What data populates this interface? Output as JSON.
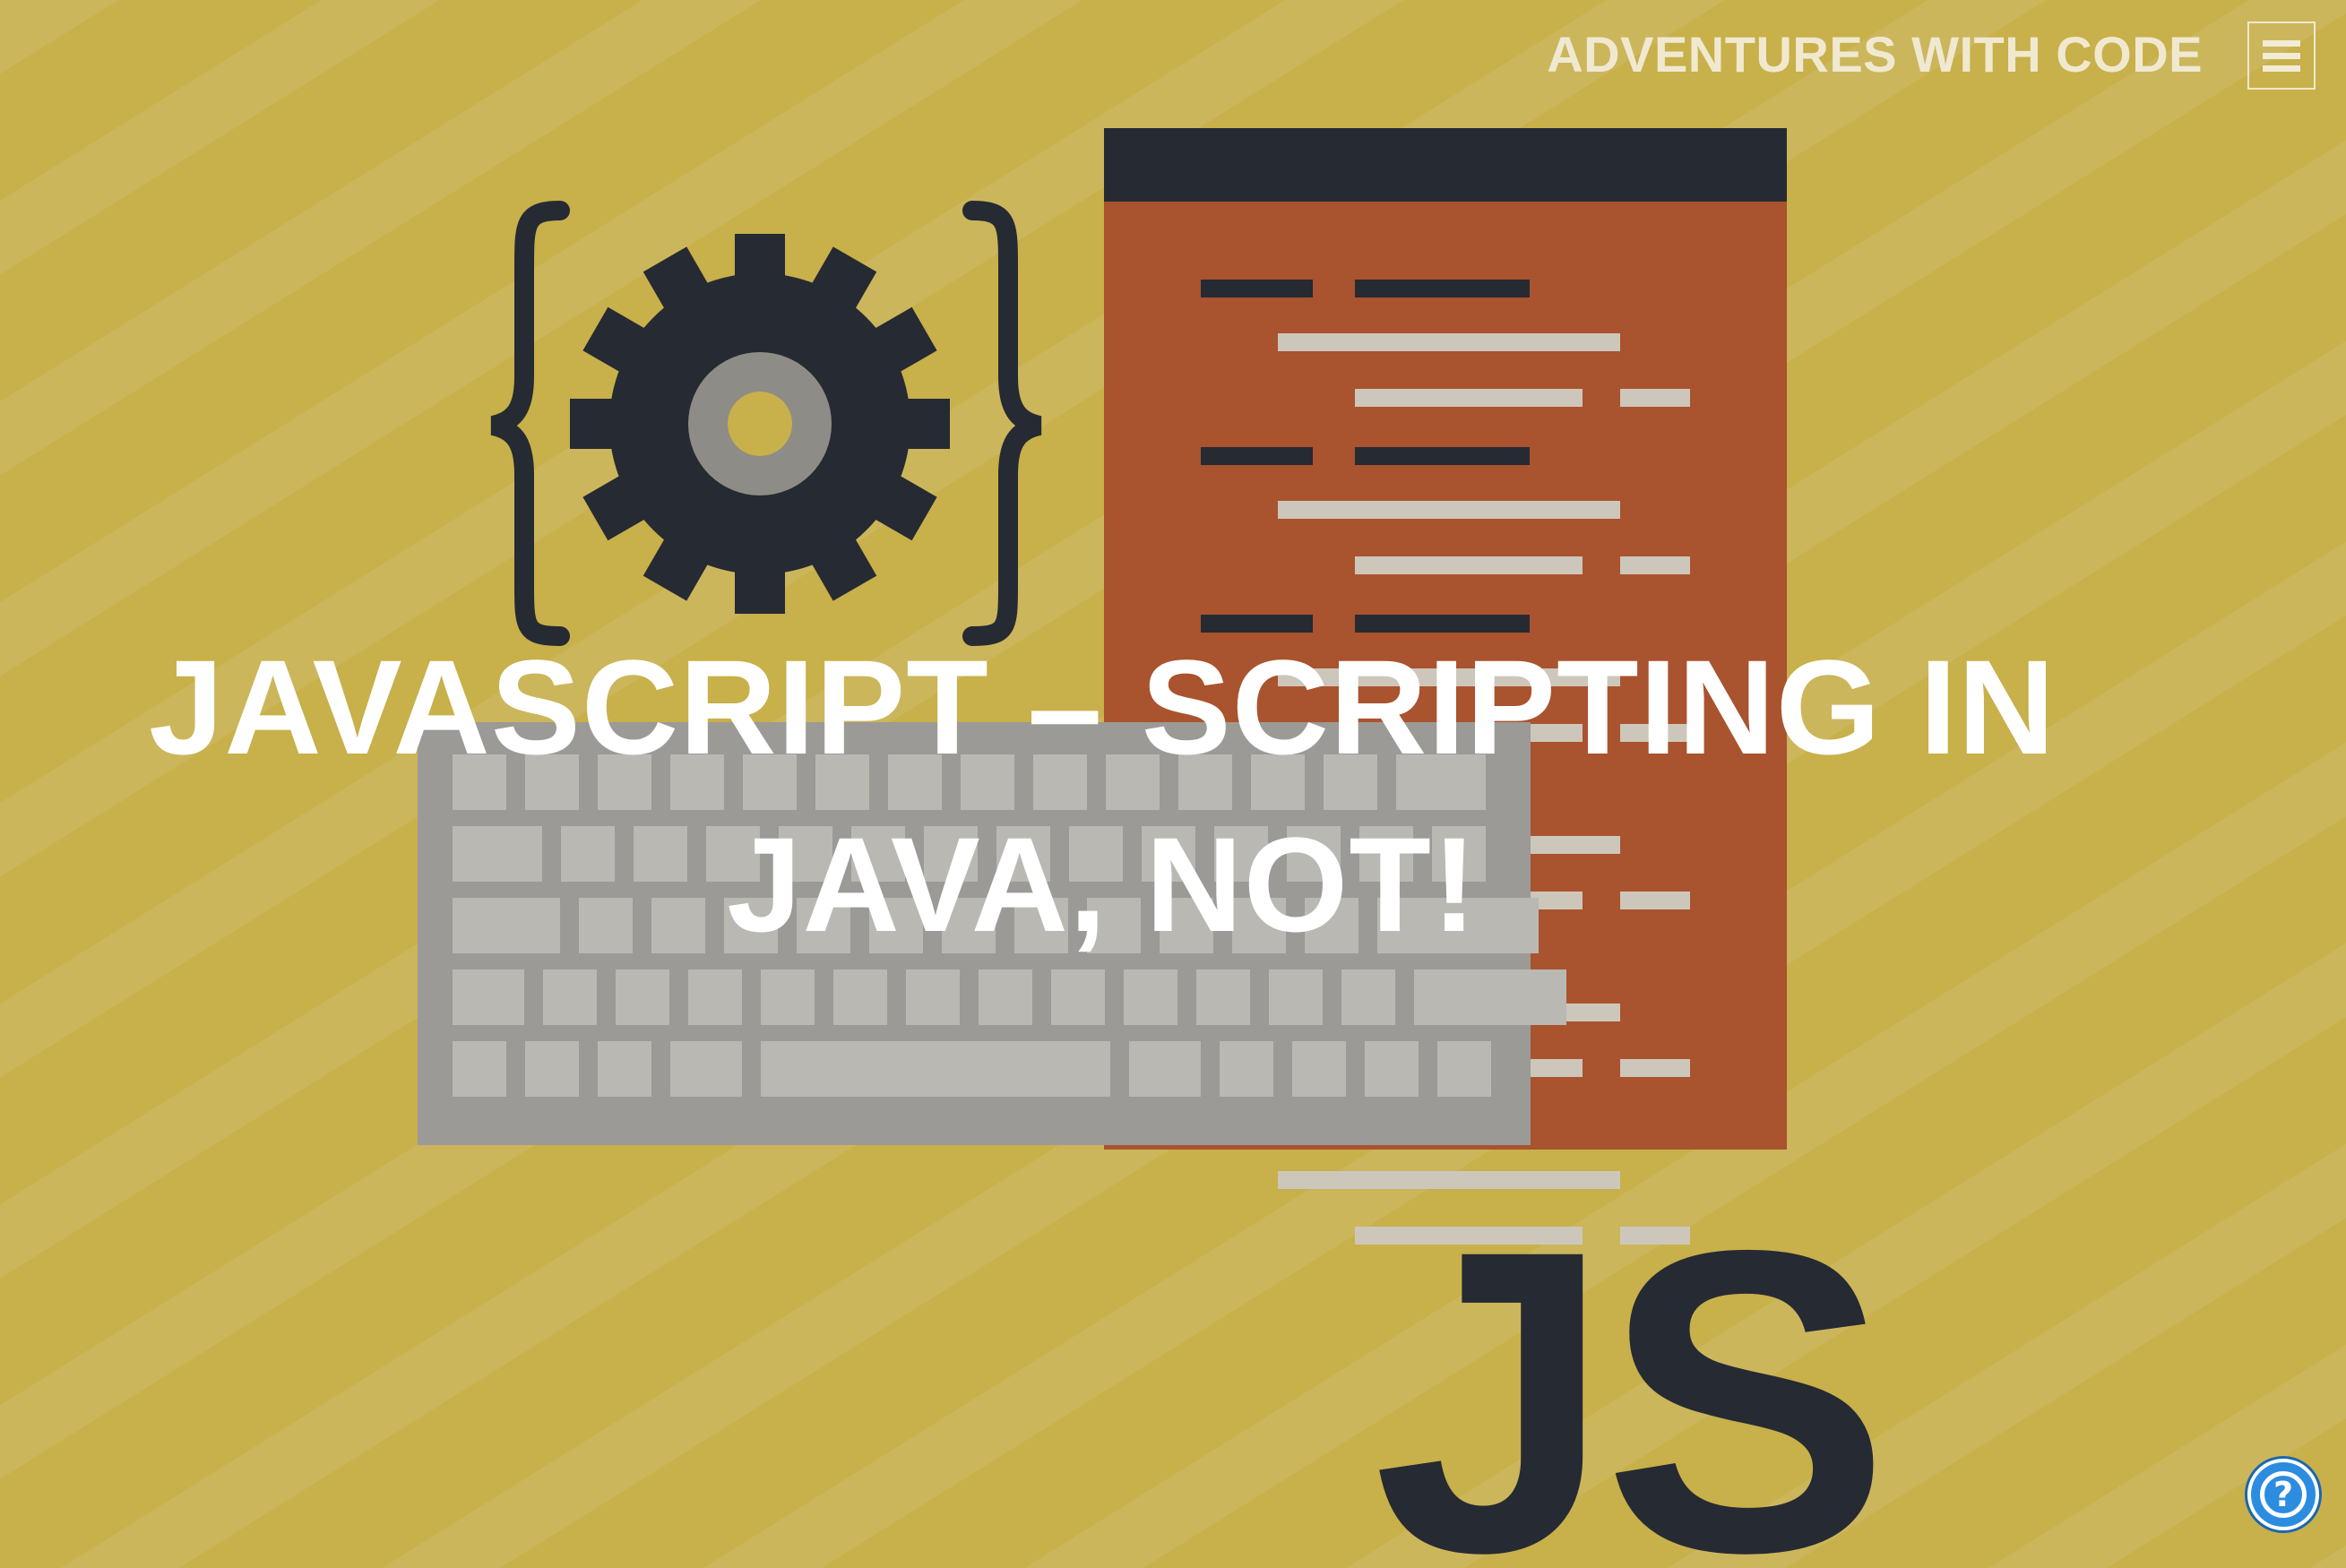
{
  "site": {
    "title": "ADVENTURES WITH CODE",
    "menu_icon": "hamburger-icon"
  },
  "post": {
    "title": "JAVASCRIPT – SCRIPTING IN JAVA, NOT!"
  },
  "hero_image": {
    "badge_text": "JS",
    "icons": [
      "gear-icon",
      "curly-braces-icon",
      "code-document-icon",
      "keyboard-icon"
    ]
  },
  "help": {
    "icon": "question-mark-icon",
    "label": "?"
  },
  "colors": {
    "background": "#c8b04a",
    "stripe": "#d2c27a",
    "document": "#a9532f",
    "document_header": "#262a33",
    "dark": "#262a33",
    "gear_hub": "#8e8c86",
    "keyboard": "#9b9a96",
    "key": "#b9b8b2",
    "code_line_light": "#cdc7bb",
    "help_button": "#2c8ce0"
  }
}
